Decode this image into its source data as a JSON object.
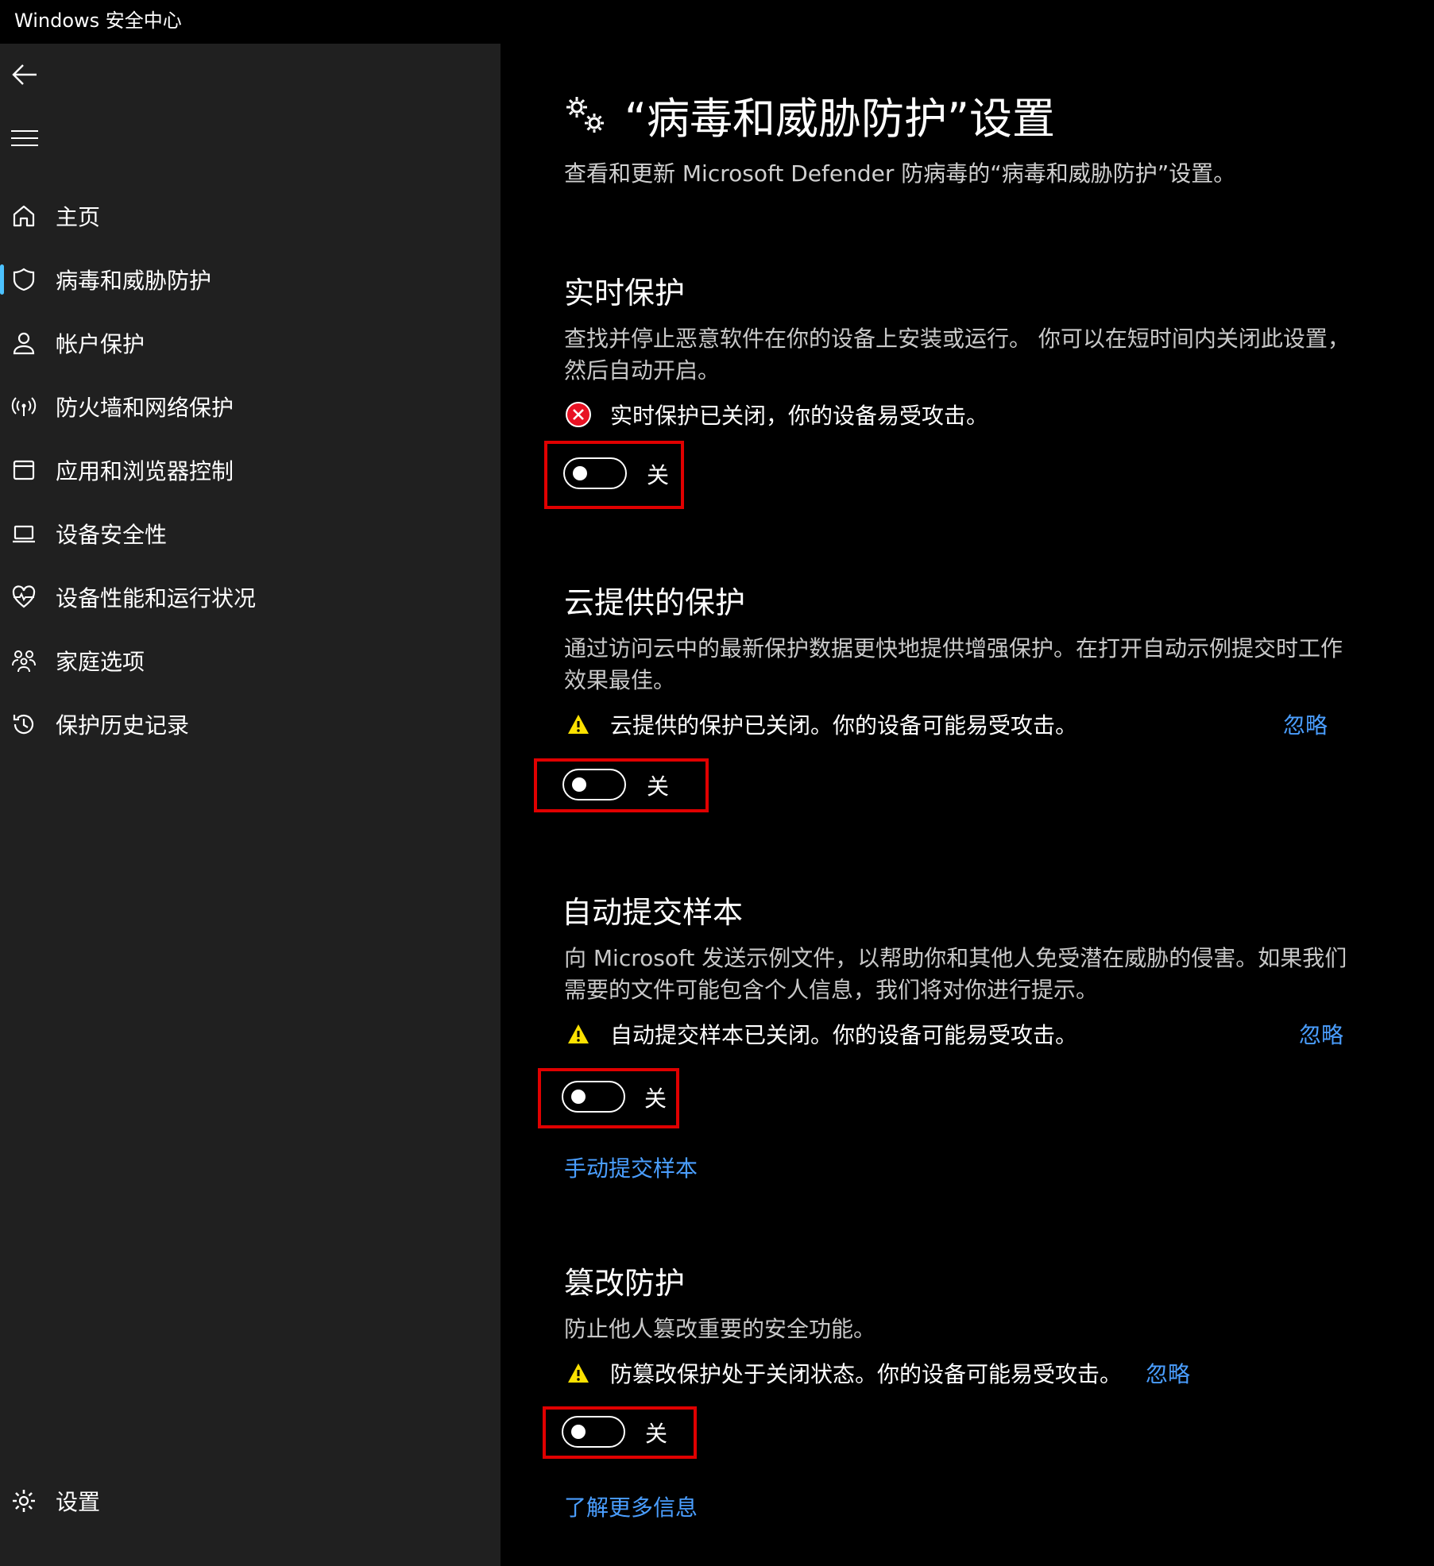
{
  "window": {
    "title": "Windows 安全中心"
  },
  "sidebar": {
    "items": [
      {
        "label": "主页",
        "icon": "home-icon"
      },
      {
        "label": "病毒和威胁防护",
        "icon": "shield-icon"
      },
      {
        "label": "帐户保护",
        "icon": "person-icon"
      },
      {
        "label": "防火墙和网络保护",
        "icon": "wifi-antenna-icon"
      },
      {
        "label": "应用和浏览器控制",
        "icon": "browser-window-icon"
      },
      {
        "label": "设备安全性",
        "icon": "laptop-icon"
      },
      {
        "label": "设备性能和运行状况",
        "icon": "heart-pulse-icon"
      },
      {
        "label": "家庭选项",
        "icon": "family-icon"
      },
      {
        "label": "保护历史记录",
        "icon": "history-icon"
      }
    ],
    "settings_label": "设置"
  },
  "main": {
    "title": "“病毒和威胁防护”设置",
    "subtitle": "查看和更新 Microsoft Defender 防病毒的“病毒和威胁防护”设置。",
    "sections": [
      {
        "title": "实时保护",
        "desc": "查找并停止恶意软件在你的设备上安装或运行。 你可以在短时间内关闭此设置，然后自动开启。",
        "status": "实时保护已关闭，你的设备易受攻击。",
        "status_icon": "error-circle-icon",
        "toggle_label": "关"
      },
      {
        "title": "云提供的保护",
        "desc": "通过访问云中的最新保护数据更快地提供增强保护。在打开自动示例提交时工作效果最佳。",
        "status": "云提供的保护已关闭。你的设备可能易受攻击。",
        "status_icon": "warning-icon",
        "dismiss": "忽略",
        "toggle_label": "关"
      },
      {
        "title": "自动提交样本",
        "desc": "向 Microsoft 发送示例文件，以帮助你和其他人免受潜在威胁的侵害。如果我们需要的文件可能包含个人信息，我们将对你进行提示。",
        "status": "自动提交样本已关闭。你的设备可能易受攻击。",
        "status_icon": "warning-icon",
        "dismiss": "忽略",
        "toggle_label": "关",
        "link": "手动提交样本"
      },
      {
        "title": "篡改防护",
        "desc": "防止他人篡改重要的安全功能。",
        "status": "防篡改保护处于关闭状态。你的设备可能易受攻击。",
        "status_icon": "warning-icon",
        "dismiss": "忽略",
        "toggle_label": "关",
        "link": "了解更多信息"
      }
    ]
  },
  "colors": {
    "accent_link": "#4a9eff",
    "highlight_box": "#e00000",
    "error": "#e81123",
    "warning": "#fce100"
  }
}
